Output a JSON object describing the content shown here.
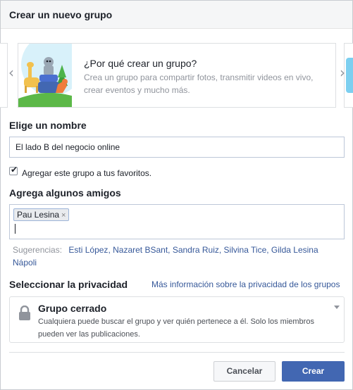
{
  "dialog": {
    "title": "Crear un nuevo grupo"
  },
  "carousel": {
    "heading": "¿Por qué crear un grupo?",
    "text": "Crea un grupo para compartir fotos, transmitir videos en vivo, crear eventos y mucho más.",
    "prev_icon": "chevron-left-icon",
    "next_icon": "chevron-right-icon"
  },
  "name_section": {
    "label": "Elige un nombre",
    "value": "El lado B del negocio online"
  },
  "favorites": {
    "checked": true,
    "label": "Agregar este grupo a tus favoritos."
  },
  "friends_section": {
    "label": "Agrega algunos amigos",
    "tokens": [
      {
        "name": "Pau Lesina",
        "remove": "×"
      }
    ]
  },
  "suggestions": {
    "label": "Sugerencias:",
    "names": [
      "Esti López",
      "Nazaret BSant",
      "Sandra Ruiz",
      "Silvina Tice",
      "Gilda Lesina Nápoli"
    ]
  },
  "privacy": {
    "label": "Seleccionar la privacidad",
    "more_info": "Más información sobre la privacidad de los grupos",
    "option_title": "Grupo cerrado",
    "option_desc": "Cualquiera puede buscar el grupo y ver quién pertenece a él. Solo los miembros pueden ver las publicaciones.",
    "icon": "lock-icon"
  },
  "buttons": {
    "cancel": "Cancelar",
    "create": "Crear"
  },
  "colors": {
    "accent": "#4267b2",
    "link": "#365899",
    "header_bg": "#f5f6f7"
  }
}
